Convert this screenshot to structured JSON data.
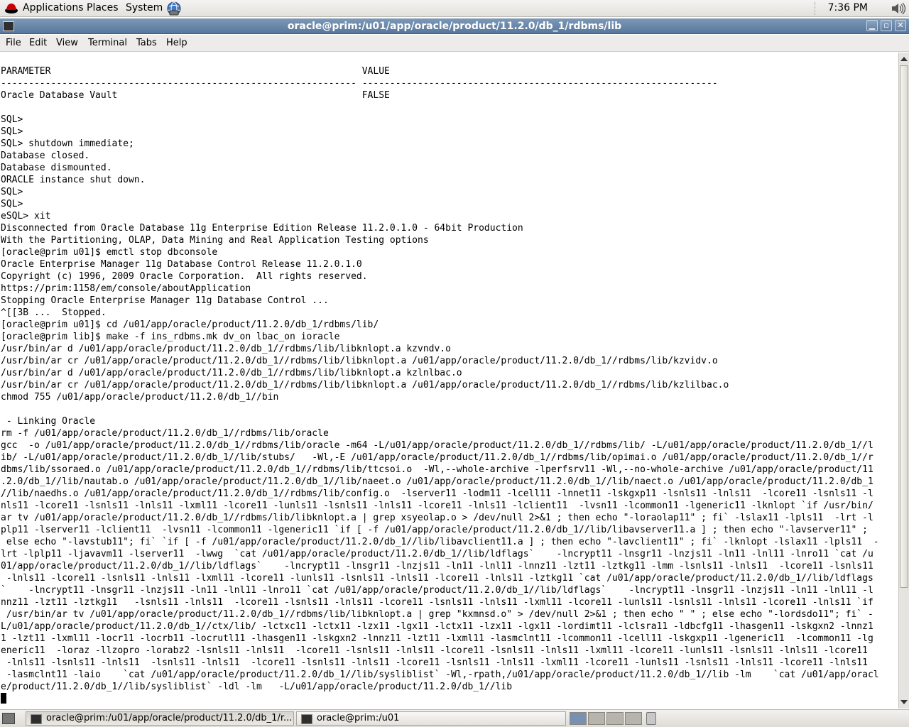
{
  "panel": {
    "menus": [
      "Applications",
      "Places",
      "System"
    ],
    "clock": "7:36 PM"
  },
  "window": {
    "title": "oracle@prim:/u01/app/oracle/product/11.2.0/db_1/rdbms/lib",
    "buttons": [
      "minimize",
      "maximize",
      "close"
    ]
  },
  "menubar": {
    "items": [
      "File",
      "Edit",
      "View",
      "Terminal",
      "Tabs",
      "Help"
    ]
  },
  "terminal": {
    "lines": [
      "PARAMETER                                                        VALUE",
      "---------------------------------------------------------------- ----------------------------------------------------------------",
      "Oracle Database Vault                                            FALSE",
      "",
      "SQL>",
      "SQL>",
      "SQL> shutdown immediate;",
      "Database closed.",
      "Database dismounted.",
      "ORACLE instance shut down.",
      "SQL>",
      "SQL>",
      "eSQL> xit",
      "Disconnected from Oracle Database 11g Enterprise Edition Release 11.2.0.1.0 - 64bit Production",
      "With the Partitioning, OLAP, Data Mining and Real Application Testing options",
      "[oracle@prim u01]$ emctl stop dbconsole",
      "Oracle Enterprise Manager 11g Database Control Release 11.2.0.1.0",
      "Copyright (c) 1996, 2009 Oracle Corporation.  All rights reserved.",
      "https://prim:1158/em/console/aboutApplication",
      "Stopping Oracle Enterprise Manager 11g Database Control ...",
      "^[[3B ...  Stopped.",
      "[oracle@prim u01]$ cd /u01/app/oracle/product/11.2.0/db_1/rdbms/lib/",
      "[oracle@prim lib]$ make -f ins_rdbms.mk dv_on lbac_on ioracle",
      "/usr/bin/ar d /u01/app/oracle/product/11.2.0/db_1//rdbms/lib/libknlopt.a kzvndv.o",
      "/usr/bin/ar cr /u01/app/oracle/product/11.2.0/db_1//rdbms/lib/libknlopt.a /u01/app/oracle/product/11.2.0/db_1//rdbms/lib/kzvidv.o",
      "/usr/bin/ar d /u01/app/oracle/product/11.2.0/db_1//rdbms/lib/libknlopt.a kzlnlbac.o",
      "/usr/bin/ar cr /u01/app/oracle/product/11.2.0/db_1//rdbms/lib/libknlopt.a /u01/app/oracle/product/11.2.0/db_1//rdbms/lib/kzlilbac.o",
      "chmod 755 /u01/app/oracle/product/11.2.0/db_1//bin",
      "",
      " - Linking Oracle",
      "rm -f /u01/app/oracle/product/11.2.0/db_1//rdbms/lib/oracle",
      "gcc  -o /u01/app/oracle/product/11.2.0/db_1//rdbms/lib/oracle -m64 -L/u01/app/oracle/product/11.2.0/db_1//rdbms/lib/ -L/u01/app/oracle/product/11.2.0/db_1//l",
      "ib/ -L/u01/app/oracle/product/11.2.0/db_1//lib/stubs/   -Wl,-E /u01/app/oracle/product/11.2.0/db_1//rdbms/lib/opimai.o /u01/app/oracle/product/11.2.0/db_1//r",
      "dbms/lib/ssoraed.o /u01/app/oracle/product/11.2.0/db_1//rdbms/lib/ttcsoi.o  -Wl,--whole-archive -lperfsrv11 -Wl,--no-whole-archive /u01/app/oracle/product/11",
      ".2.0/db_1//lib/nautab.o /u01/app/oracle/product/11.2.0/db_1//lib/naeet.o /u01/app/oracle/product/11.2.0/db_1//lib/naect.o /u01/app/oracle/product/11.2.0/db_1",
      "//lib/naedhs.o /u01/app/oracle/product/11.2.0/db_1//rdbms/lib/config.o  -lserver11 -lodm11 -lcell11 -lnnet11 -lskgxp11 -lsnls11 -lnls11  -lcore11 -lsnls11 -l",
      "nls11 -lcore11 -lsnls11 -lnls11 -lxml11 -lcore11 -lunls11 -lsnls11 -lnls11 -lcore11 -lnls11 -lclient11  -lvsn11 -lcommon11 -lgeneric11 -lknlopt `if /usr/bin/",
      "ar tv /u01/app/oracle/product/11.2.0/db_1//rdbms/lib/libknlopt.a | grep xsyeolap.o > /dev/null 2>&1 ; then echo \"-loraolap11\" ; fi` -lslax11 -lpls11  -lrt -l",
      "plp11 -lserver11 -lclient11  -lvsn11 -lcommon11 -lgeneric11 `if [ -f /u01/app/oracle/product/11.2.0/db_1//lib/libavserver11.a ] ; then echo \"-lavserver11\" ;",
      " else echo \"-lavstub11\"; fi` `if [ -f /u01/app/oracle/product/11.2.0/db_1//lib/libavclient11.a ] ; then echo \"-lavclient11\" ; fi` -lknlopt -lslax11 -lpls11  -",
      "lrt -lplp11 -ljavavm11 -lserver11  -lwwg  `cat /u01/app/oracle/product/11.2.0/db_1//lib/ldflags`    -lncrypt11 -lnsgr11 -lnzjs11 -ln11 -lnl11 -lnro11 `cat /u",
      "01/app/oracle/product/11.2.0/db_1//lib/ldflags`    -lncrypt11 -lnsgr11 -lnzjs11 -ln11 -lnl11 -lnnz11 -lzt11 -lztkg11 -lmm -lsnls11 -lnls11  -lcore11 -lsnls11",
      " -lnls11 -lcore11 -lsnls11 -lnls11 -lxml11 -lcore11 -lunls11 -lsnls11 -lnls11 -lcore11 -lnls11 -lztkg11 `cat /u01/app/oracle/product/11.2.0/db_1//lib/ldflags",
      "`    -lncrypt11 -lnsgr11 -lnzjs11 -ln11 -lnl11 -lnro11 `cat /u01/app/oracle/product/11.2.0/db_1//lib/ldflags`    -lncrypt11 -lnsgr11 -lnzjs11 -ln11 -lnl11 -l",
      "nnz11 -lzt11 -lztkg11   -lsnls11 -lnls11  -lcore11 -lsnls11 -lnls11 -lcore11 -lsnls11 -lnls11 -lxml11 -lcore11 -lunls11 -lsnls11 -lnls11 -lcore11 -lnls11 `if",
      " /usr/bin/ar tv /u01/app/oracle/product/11.2.0/db_1//rdbms/lib/libknlopt.a | grep \"kxmnsd.o\" > /dev/null 2>&1 ; then echo \" \" ; else echo \"-lordsdo11\"; fi` -",
      "L/u01/app/oracle/product/11.2.0/db_1//ctx/lib/ -lctxc11 -lctx11 -lzx11 -lgx11 -lctx11 -lzx11 -lgx11 -lordimt11 -lclsra11 -ldbcfg11 -lhasgen11 -lskgxn2 -lnnz1",
      "1 -lzt11 -lxml11 -locr11 -locrb11 -locrutl11 -lhasgen11 -lskgxn2 -lnnz11 -lzt11 -lxml11 -lasmclnt11 -lcommon11 -lcell11 -lskgxp11 -lgeneric11  -lcommon11 -lg",
      "eneric11  -loraz -llzopro -lorabz2 -lsnls11 -lnls11  -lcore11 -lsnls11 -lnls11 -lcore11 -lsnls11 -lnls11 -lxml11 -lcore11 -lunls11 -lsnls11 -lnls11 -lcore11",
      " -lnls11 -lsnls11 -lnls11  -lsnls11 -lnls11  -lcore11 -lsnls11 -lnls11 -lcore11 -lsnls11 -lnls11 -lxml11 -lcore11 -lunls11 -lsnls11 -lnls11 -lcore11 -lnls11",
      " -lasmclnt11 -laio    `cat /u01/app/oracle/product/11.2.0/db_1//lib/sysliblist` -Wl,-rpath,/u01/app/oracle/product/11.2.0/db_1//lib -lm    `cat /u01/app/oracl",
      "e/product/11.2.0/db_1//lib/sysliblist` -ldl -lm   -L/u01/app/oracle/product/11.2.0/db_1//lib"
    ]
  },
  "taskbar": {
    "tasks": [
      {
        "label": "oracle@prim:/u01/app/oracle/product/11.2.0/db_1/r...",
        "active": true
      },
      {
        "label": "oracle@prim:/u01",
        "active": false
      }
    ]
  }
}
